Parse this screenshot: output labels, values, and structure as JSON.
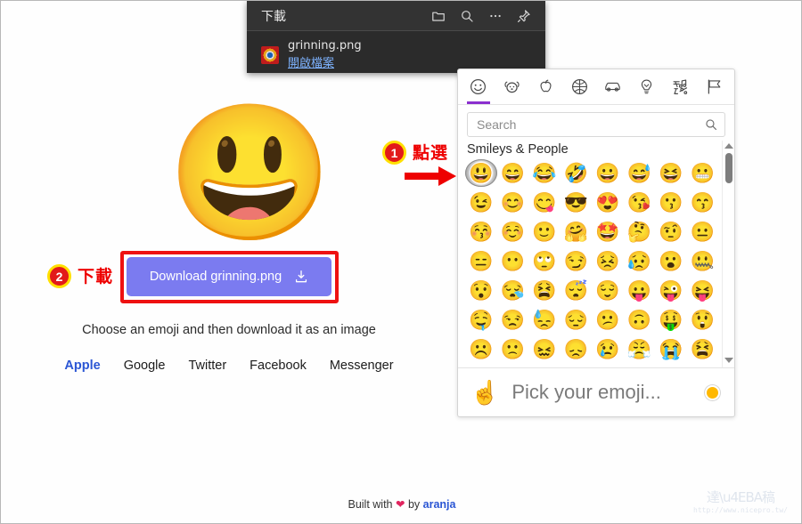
{
  "site": {
    "big_emoji": "😃",
    "big_emoji_name": "grinning-face-emoji",
    "download_button_label": "Download grinning.png",
    "subtitle": "Choose an emoji and then download it as an image",
    "platforms": [
      {
        "label": "Apple",
        "active": true
      },
      {
        "label": "Google",
        "active": false
      },
      {
        "label": "Twitter",
        "active": false
      },
      {
        "label": "Facebook",
        "active": false
      },
      {
        "label": "Messenger",
        "active": false
      }
    ],
    "footer": {
      "prefix": "Built with",
      "heart": "❤",
      "middle": "by",
      "brand": "aranja"
    }
  },
  "annotations": [
    {
      "number": "1",
      "text": "點選"
    },
    {
      "number": "2",
      "text": "下載"
    }
  ],
  "download_popup": {
    "title": "下載",
    "header_icons": [
      "folder-icon",
      "search-icon",
      "more-icon",
      "pin-icon"
    ],
    "file_name": "grinning.png",
    "open_file_link": "開啟檔案"
  },
  "picker": {
    "tabs": [
      {
        "name": "smileys-people",
        "icon": "smiley-icon",
        "active": true
      },
      {
        "name": "animals-nature",
        "icon": "dog-icon",
        "active": false
      },
      {
        "name": "food-drink",
        "icon": "apple-icon",
        "active": false
      },
      {
        "name": "activity",
        "icon": "basketball-icon",
        "active": false
      },
      {
        "name": "travel-places",
        "icon": "car-icon",
        "active": false
      },
      {
        "name": "objects",
        "icon": "lightbulb-icon",
        "active": false
      },
      {
        "name": "symbols",
        "icon": "symbols-icon",
        "active": false
      },
      {
        "name": "flags",
        "icon": "flag-icon",
        "active": false
      }
    ],
    "active_tab_color": "#8b2fcf",
    "search_placeholder": "Search",
    "search_value": "",
    "category_label": "Smileys & People",
    "selected_index": 0,
    "emojis": [
      "😃",
      "😄",
      "😂",
      "🤣",
      "😀",
      "😅",
      "😆",
      "😬",
      "😉",
      "😊",
      "😋",
      "😎",
      "😍",
      "😘",
      "😗",
      "😙",
      "😚",
      "☺️",
      "🙂",
      "🤗",
      "🤩",
      "🤔",
      "🤨",
      "😐",
      "😑",
      "😶",
      "🙄",
      "😏",
      "😣",
      "😥",
      "😮",
      "🤐",
      "😯",
      "😪",
      "😫",
      "😴",
      "😌",
      "😛",
      "😜",
      "😝",
      "🤤",
      "😒",
      "😓",
      "😔",
      "😕",
      "🙃",
      "🤑",
      "😲",
      "☹️",
      "🙁",
      "😖",
      "😞",
      "😢",
      "😤",
      "😭",
      "😫"
    ],
    "footer": {
      "hand_emoji": "☝️",
      "hint": "Pick your emoji...",
      "skin_tone_color": "#ffb800"
    },
    "scrollbar": {
      "position": "near-top"
    }
  },
  "watermark": {
    "logo_text": "達\\u4EBA稿",
    "url": "http://www.nicepro.tw/"
  }
}
